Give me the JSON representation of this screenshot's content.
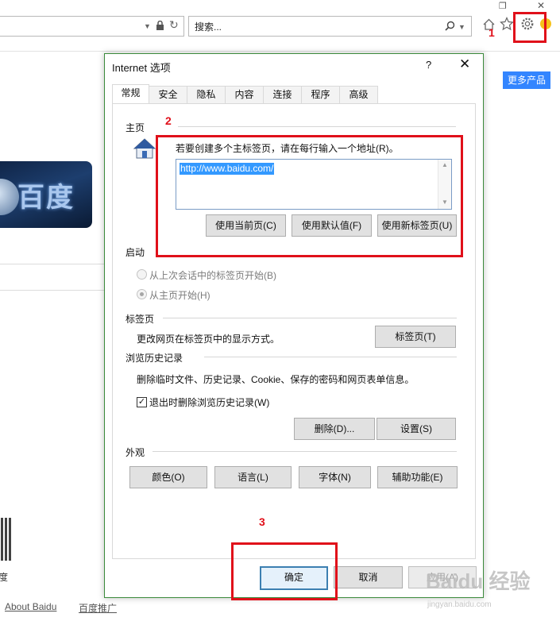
{
  "browser": {
    "window_controls": {
      "restore": "❐",
      "close": "✕"
    },
    "address_icons": [
      "chevron-down-icon",
      "lock-icon",
      "refresh-icon"
    ],
    "search": {
      "placeholder": "搜索..."
    },
    "right_icons": [
      "home-icon",
      "star-icon",
      "gear-icon",
      "smiley-icon"
    ]
  },
  "page": {
    "more_products": "更多产品",
    "logo_text": "百度",
    "qr_caption": "度",
    "footer_links": [
      "About  Baidu",
      "百度推广"
    ]
  },
  "dialog": {
    "title": "Internet 选项",
    "help": "?",
    "close": "✕",
    "tabs": [
      "常规",
      "安全",
      "隐私",
      "内容",
      "连接",
      "程序",
      "高级"
    ],
    "active_tab": "常规",
    "home": {
      "section": "主页",
      "instruction": "若要创建多个主标签页，请在每行输入一个地址(R)。",
      "url": "http://www.baidu.com/",
      "buttons": [
        "使用当前页(C)",
        "使用默认值(F)",
        "使用新标签页(U)"
      ]
    },
    "startup": {
      "section": "启动",
      "options": [
        "从上次会话中的标签页开始(B)",
        "从主页开始(H)"
      ],
      "selected": "从主页开始(H)"
    },
    "tabs_section": {
      "section": "标签页",
      "description": "更改网页在标签页中的显示方式。",
      "button": "标签页(T)"
    },
    "history": {
      "section": "浏览历史记录",
      "description": "删除临时文件、历史记录、Cookie、保存的密码和网页表单信息。",
      "checkbox": "退出时删除浏览历史记录(W)",
      "checked": true,
      "buttons": [
        "删除(D)...",
        "设置(S)"
      ]
    },
    "appearance": {
      "section": "外观",
      "buttons": [
        "颜色(O)",
        "语言(L)",
        "字体(N)",
        "辅助功能(E)"
      ]
    },
    "footer_buttons": {
      "ok": "确定",
      "cancel": "取消",
      "apply": "应用(A)"
    }
  },
  "annotations": {
    "step1": "1",
    "step2": "2",
    "step3": "3",
    "color": "#e0101a"
  },
  "watermark": {
    "brand": "Baidu 经验",
    "url": "jingyan.baidu.com"
  }
}
